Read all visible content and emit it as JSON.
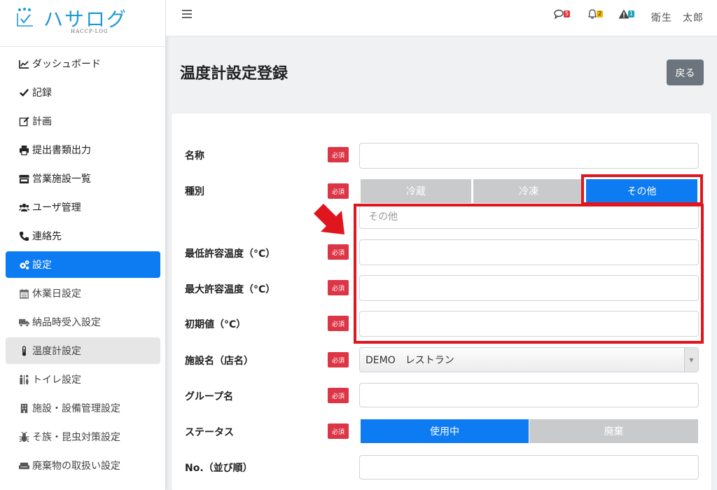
{
  "app": {
    "logo_text": "ハサログ",
    "logo_sub": "HACCP-LOG"
  },
  "sidebar": {
    "items": [
      {
        "label": "ダッシュボード",
        "icon": "chart-line-icon"
      },
      {
        "label": "記録",
        "icon": "check-icon"
      },
      {
        "label": "計画",
        "icon": "edit-icon"
      },
      {
        "label": "提出書類出力",
        "icon": "print-icon"
      },
      {
        "label": "営業施設一覧",
        "icon": "store-icon"
      },
      {
        "label": "ユーザ管理",
        "icon": "users-icon"
      },
      {
        "label": "連絡先",
        "icon": "phone-icon"
      },
      {
        "label": "設定",
        "icon": "cogs-icon"
      },
      {
        "label": "休業日設定",
        "icon": "calendar-icon"
      },
      {
        "label": "納品時受入設定",
        "icon": "truck-icon"
      },
      {
        "label": "温度計設定",
        "icon": "thermometer-icon"
      },
      {
        "label": "トイレ設定",
        "icon": "restroom-icon"
      },
      {
        "label": "施設・設備管理設定",
        "icon": "building-icon"
      },
      {
        "label": "そ族・昆虫対策設定",
        "icon": "bug-icon"
      },
      {
        "label": "廃棄物の取扱い設定",
        "icon": "couch-icon"
      }
    ]
  },
  "topbar": {
    "messages_count": "5",
    "notifications_count": "2",
    "alerts_count": "1",
    "user_name": "衛生　太郎"
  },
  "page": {
    "title": "温度計設定登録",
    "back_label": "戻る"
  },
  "form": {
    "required_label": "必須",
    "name_label": "名称",
    "type_label": "種別",
    "type_options": [
      "冷蔵",
      "冷凍",
      "その他"
    ],
    "type_selected": "その他",
    "other_placeholder": "その他",
    "min_temp_label": "最低許容温度（°C）",
    "max_temp_label": "最大許容温度（°C）",
    "initial_label": "初期値（°C）",
    "facility_label": "施設名（店名）",
    "facility_value": "DEMO　レストラン",
    "group_label": "グループ名",
    "status_label": "ステータス",
    "status_options": [
      "使用中",
      "廃棄"
    ],
    "status_selected": "使用中",
    "order_label": "No.（並び順）"
  },
  "colors": {
    "primary": "#0d7bf2",
    "required": "#dc3545",
    "annotation": "#e0161f",
    "brand": "#1f9ad6"
  }
}
